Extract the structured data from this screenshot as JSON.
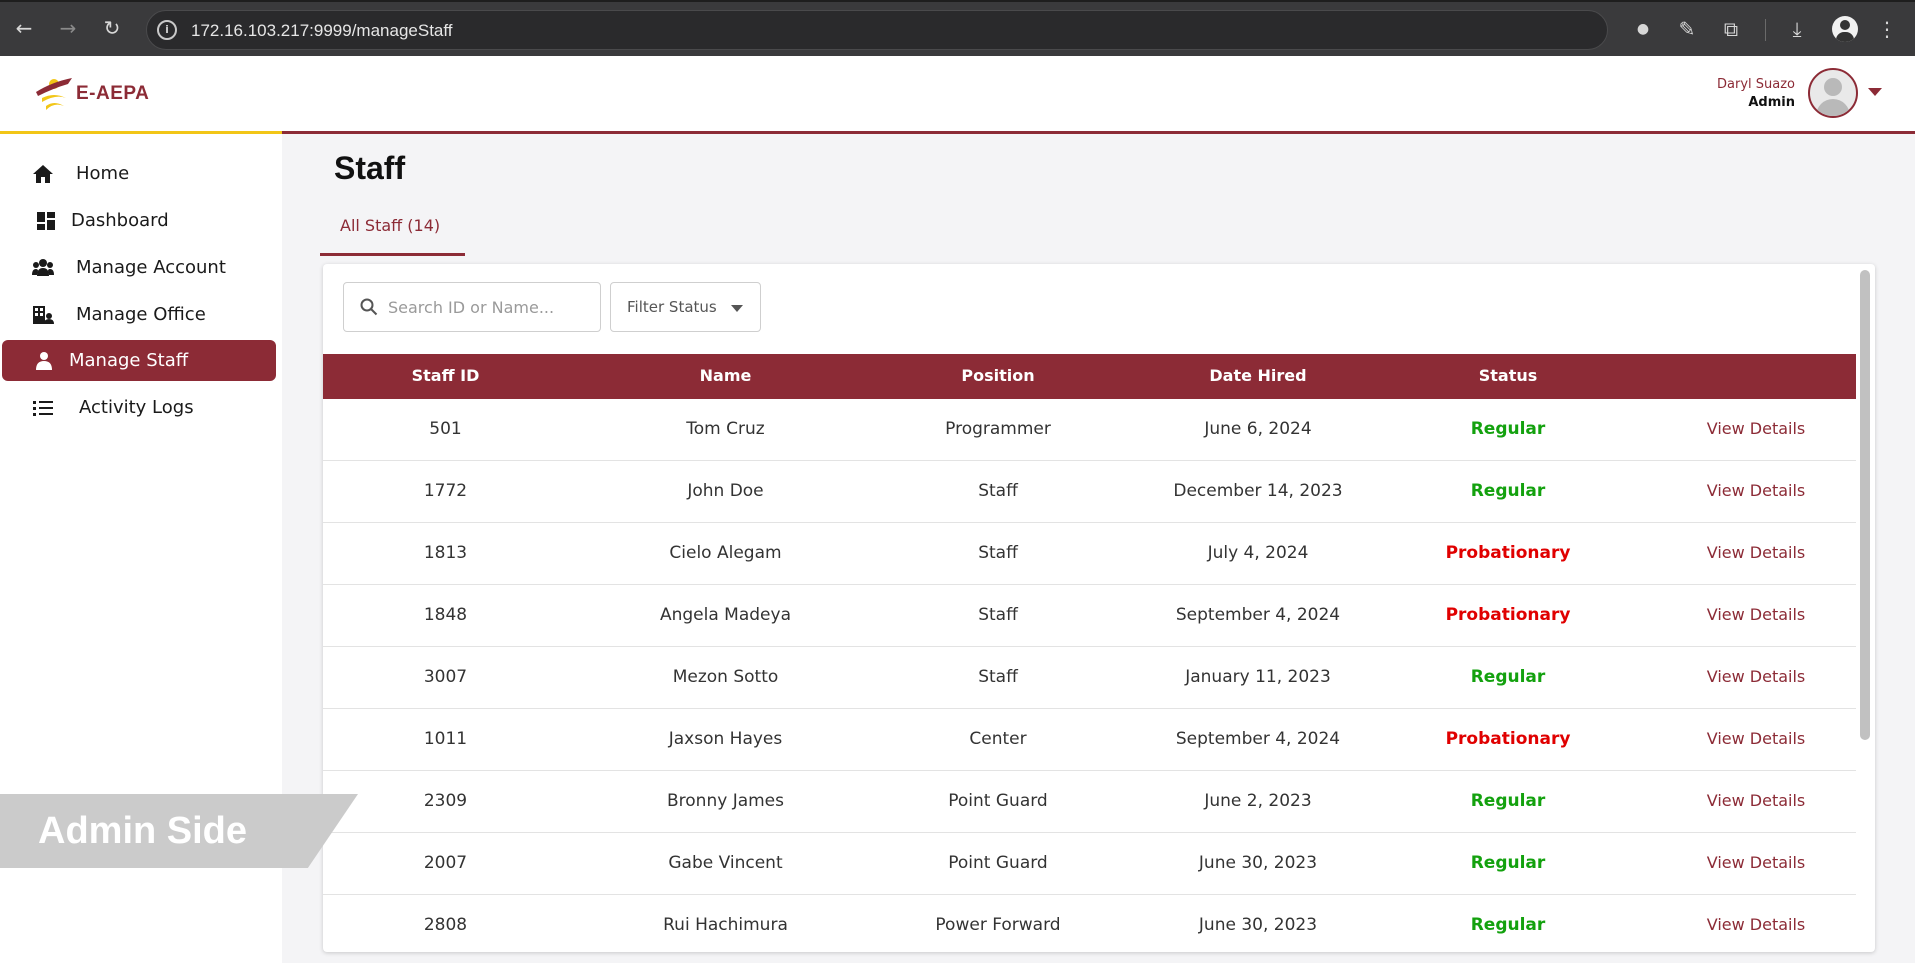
{
  "browser": {
    "url": "172.16.103.217:9999/manageStaff",
    "back_icon": "←",
    "forward_icon": "→",
    "reload_icon": "↻",
    "download_icon": "⤓",
    "extensions_icon": "⧉",
    "eyedropper_icon": "✎",
    "menu_icon": "⋮"
  },
  "app": {
    "logo_text": "E-AEPA",
    "user_name": "Daryl Suazo",
    "user_role": "Admin"
  },
  "sidebar": {
    "items": [
      {
        "label": "Home",
        "icon": "home-icon"
      },
      {
        "label": "Dashboard",
        "icon": "dashboard-icon"
      },
      {
        "label": "Manage Account",
        "icon": "users-icon"
      },
      {
        "label": "Manage Office",
        "icon": "building-icon"
      },
      {
        "label": "Manage Staff",
        "icon": "person-icon",
        "active": true
      },
      {
        "label": "Activity Logs",
        "icon": "list-icon"
      }
    ]
  },
  "watermark": "Admin Side",
  "page": {
    "title": "Staff",
    "tab_label": "All Staff (14)",
    "search_placeholder": "Search ID or Name...",
    "filter_label": "Filter Status"
  },
  "colors": {
    "brand": "#8c2b36",
    "accent": "#f2c617",
    "regular": "#13a10e",
    "probationary": "#e00000"
  },
  "table": {
    "headers": [
      "Staff ID",
      "Name",
      "Position",
      "Date Hired",
      "Status"
    ],
    "action_label": "View Details",
    "rows": [
      {
        "id": "501",
        "name": "Tom Cruz",
        "position": "Programmer",
        "date": "June 6, 2024",
        "status": "Regular"
      },
      {
        "id": "1772",
        "name": "John Doe",
        "position": "Staff",
        "date": "December 14, 2023",
        "status": "Regular"
      },
      {
        "id": "1813",
        "name": "Cielo Alegam",
        "position": "Staff",
        "date": "July 4, 2024",
        "status": "Probationary"
      },
      {
        "id": "1848",
        "name": "Angela Madeya",
        "position": "Staff",
        "date": "September 4, 2024",
        "status": "Probationary"
      },
      {
        "id": "3007",
        "name": "Mezon Sotto",
        "position": "Staff",
        "date": "January 11, 2023",
        "status": "Regular"
      },
      {
        "id": "1011",
        "name": "Jaxson Hayes",
        "position": "Center",
        "date": "September 4, 2024",
        "status": "Probationary"
      },
      {
        "id": "2309",
        "name": "Bronny James",
        "position": "Point Guard",
        "date": "June 2, 2023",
        "status": "Regular"
      },
      {
        "id": "2007",
        "name": "Gabe Vincent",
        "position": "Point Guard",
        "date": "June 30, 2023",
        "status": "Regular"
      },
      {
        "id": "2808",
        "name": "Rui Hachimura",
        "position": "Power Forward",
        "date": "June 30, 2023",
        "status": "Regular"
      }
    ]
  }
}
